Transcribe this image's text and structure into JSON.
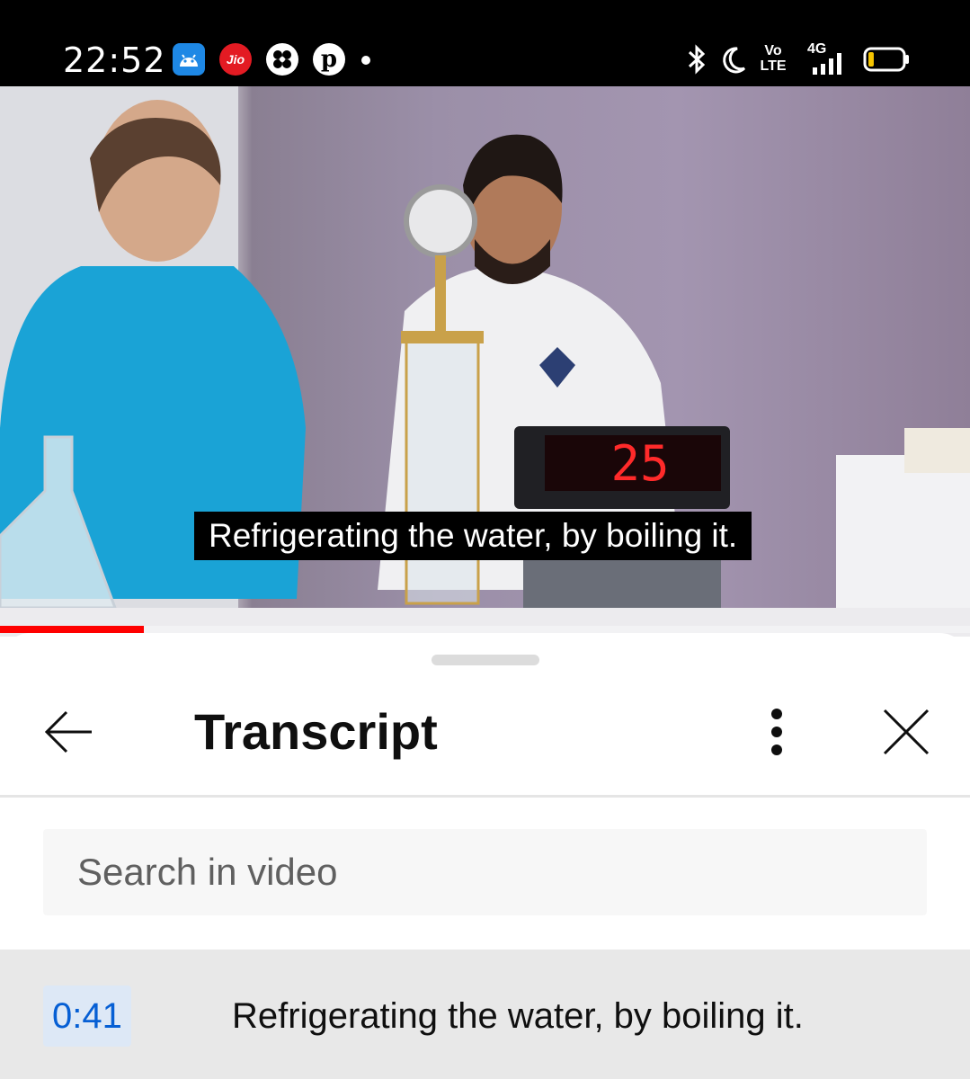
{
  "status_bar": {
    "time": "22:52",
    "notification_icons": [
      "android-icon",
      "jio-icon",
      "fan-icon",
      "pinterest-icon"
    ],
    "jio_label": "Jio",
    "volte_label": "Vo LTE",
    "network_label": "4G",
    "battery_level": 0.15
  },
  "video": {
    "caption": "Refrigerating the water, by boiling it.",
    "display_reading": "25",
    "progress": 0.148
  },
  "sheet": {
    "title": "Transcript",
    "search": {
      "placeholder": "Search in video",
      "value": ""
    },
    "segments": [
      {
        "timestamp": "0:41",
        "text": "Refrigerating the water, by boiling it."
      }
    ]
  },
  "colors": {
    "progress_red": "#ff0000",
    "timestamp_blue": "#065fd4",
    "timestamp_bg": "#dde8f6",
    "active_row_bg": "#e8e8e8"
  }
}
